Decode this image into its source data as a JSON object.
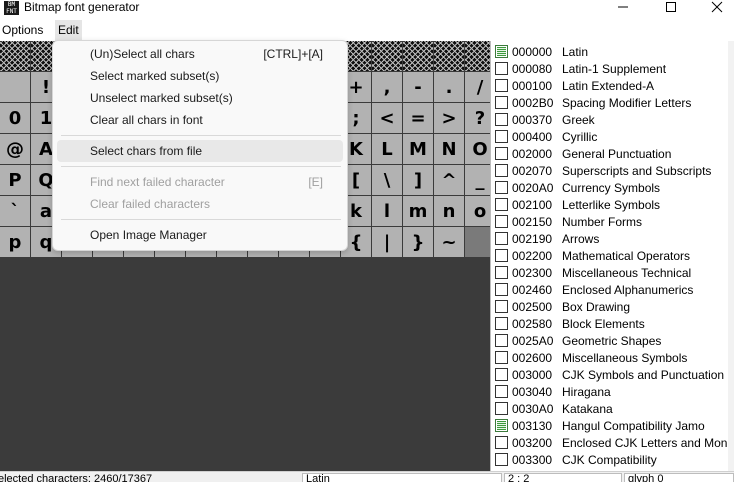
{
  "window": {
    "title": "Bitmap font generator",
    "icon_text": "BM\nFONT",
    "controls": [
      "minimize-icon",
      "maximize-icon",
      "close-icon"
    ]
  },
  "menubar": {
    "options": "Options",
    "edit": "Edit"
  },
  "edit_menu": {
    "items": [
      {
        "label": "(Un)Select all chars",
        "shortcut": "[CTRL]+[A]",
        "enabled": true
      },
      {
        "label": "Select marked subset(s)",
        "shortcut": "",
        "enabled": true
      },
      {
        "label": "Unselect marked subset(s)",
        "shortcut": "",
        "enabled": true
      },
      {
        "label": "Clear all chars in font",
        "shortcut": "",
        "enabled": true
      },
      {
        "label": "Select chars from file",
        "shortcut": "",
        "enabled": true,
        "highlighted": true
      },
      {
        "label": "Find next failed character",
        "shortcut": "[E]",
        "enabled": false
      },
      {
        "label": "Clear failed characters",
        "shortcut": "",
        "enabled": false
      },
      {
        "label": "Open Image Manager",
        "shortcut": "",
        "enabled": true
      }
    ]
  },
  "grid": {
    "rows": [
      [
        "",
        "",
        "",
        "",
        "",
        "",
        "",
        "",
        "",
        "",
        "",
        "",
        "",
        "",
        "",
        ""
      ],
      [
        "",
        "!",
        "",
        "",
        "",
        "",
        "",
        "",
        "",
        "",
        "",
        "+",
        ",",
        "-",
        ".",
        "/"
      ],
      [
        "0",
        "1",
        "",
        "",
        "",
        "",
        "",
        "",
        "",
        "",
        "",
        ";",
        "<",
        "=",
        ">",
        "?"
      ],
      [
        "@",
        "A",
        "",
        "",
        "",
        "",
        "",
        "",
        "",
        "",
        "",
        "K",
        "L",
        "M",
        "N",
        "O"
      ],
      [
        "P",
        "Q",
        "",
        "",
        "",
        "",
        "",
        "",
        "",
        "",
        "",
        "[",
        "\\",
        "]",
        "^",
        "_"
      ],
      [
        "`",
        "a",
        "",
        "",
        "",
        "",
        "",
        "",
        "",
        "",
        "",
        "k",
        "l",
        "m",
        "n",
        "o"
      ],
      [
        "p",
        "q",
        "",
        "",
        "",
        "",
        "",
        "",
        "",
        "",
        "",
        "{",
        "|",
        "}",
        "~",
        ""
      ]
    ]
  },
  "blocks": [
    {
      "code": "000000",
      "name": "Latin",
      "checked": true
    },
    {
      "code": "000080",
      "name": "Latin-1 Supplement",
      "checked": false
    },
    {
      "code": "000100",
      "name": "Latin Extended-A",
      "checked": false
    },
    {
      "code": "0002B0",
      "name": "Spacing Modifier Letters",
      "checked": false
    },
    {
      "code": "000370",
      "name": "Greek",
      "checked": false
    },
    {
      "code": "000400",
      "name": "Cyrillic",
      "checked": false
    },
    {
      "code": "002000",
      "name": "General Punctuation",
      "checked": false
    },
    {
      "code": "002070",
      "name": "Superscripts and Subscripts",
      "checked": false
    },
    {
      "code": "0020A0",
      "name": "Currency Symbols",
      "checked": false
    },
    {
      "code": "002100",
      "name": "Letterlike Symbols",
      "checked": false
    },
    {
      "code": "002150",
      "name": "Number Forms",
      "checked": false
    },
    {
      "code": "002190",
      "name": "Arrows",
      "checked": false
    },
    {
      "code": "002200",
      "name": "Mathematical Operators",
      "checked": false
    },
    {
      "code": "002300",
      "name": "Miscellaneous Technical",
      "checked": false
    },
    {
      "code": "002460",
      "name": "Enclosed Alphanumerics",
      "checked": false
    },
    {
      "code": "002500",
      "name": "Box Drawing",
      "checked": false
    },
    {
      "code": "002580",
      "name": "Block Elements",
      "checked": false
    },
    {
      "code": "0025A0",
      "name": "Geometric Shapes",
      "checked": false
    },
    {
      "code": "002600",
      "name": "Miscellaneous Symbols",
      "checked": false
    },
    {
      "code": "003000",
      "name": "CJK Symbols and Punctuation",
      "checked": false
    },
    {
      "code": "003040",
      "name": "Hiragana",
      "checked": false
    },
    {
      "code": "0030A0",
      "name": "Katakana",
      "checked": false
    },
    {
      "code": "003130",
      "name": "Hangul Compatibility Jamo",
      "checked": true
    },
    {
      "code": "003200",
      "name": "Enclosed CJK Letters and Mon",
      "checked": false
    },
    {
      "code": "003300",
      "name": "CJK Compatibility",
      "checked": false
    }
  ],
  "statusbar": {
    "selected": "elected characters: 2460/17367",
    "block": "Latin",
    "coords": "2 : 2",
    "glyph": "glyph 0"
  }
}
